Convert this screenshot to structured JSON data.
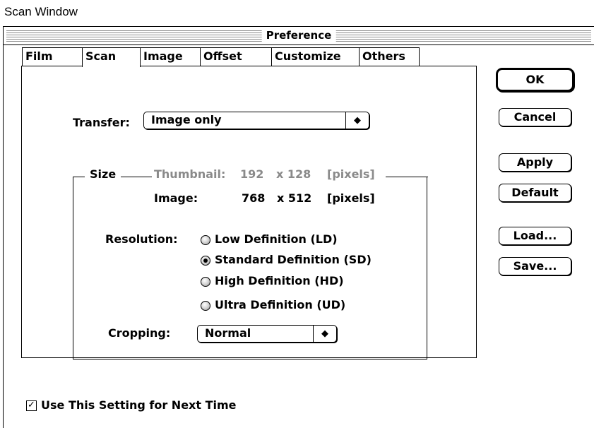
{
  "caption": "Scan Window",
  "window": {
    "title": "Preference"
  },
  "tabs": [
    "Film",
    "Scan",
    "Image",
    "Offset",
    "Customize",
    "Others"
  ],
  "active_tab": "Scan",
  "transfer": {
    "label": "Transfer:",
    "value": "Image only",
    "arrows": "◆"
  },
  "size": {
    "group_label": "Size",
    "thumbnail": {
      "label": "Thumbnail:",
      "width": "192",
      "x": "x 128",
      "unit": "[pixels]"
    },
    "image": {
      "label": "Image:",
      "width": "768",
      "x": "x 512",
      "unit": "[pixels]"
    }
  },
  "resolution": {
    "label": "Resolution:",
    "options": [
      "Low Definition (LD)",
      "Standard Definition (SD)",
      "High Definition (HD)",
      "Ultra Definition (UD)"
    ],
    "selected": "Standard Definition (SD)"
  },
  "cropping": {
    "label": "Cropping:",
    "value": "Normal"
  },
  "buttons": {
    "ok": "OK",
    "cancel": "Cancel",
    "apply": "Apply",
    "default": "Default",
    "load": "Load...",
    "save": "Save..."
  },
  "use_setting": {
    "label": "Use This Setting for Next Time",
    "checked": true,
    "mark": "✓"
  }
}
